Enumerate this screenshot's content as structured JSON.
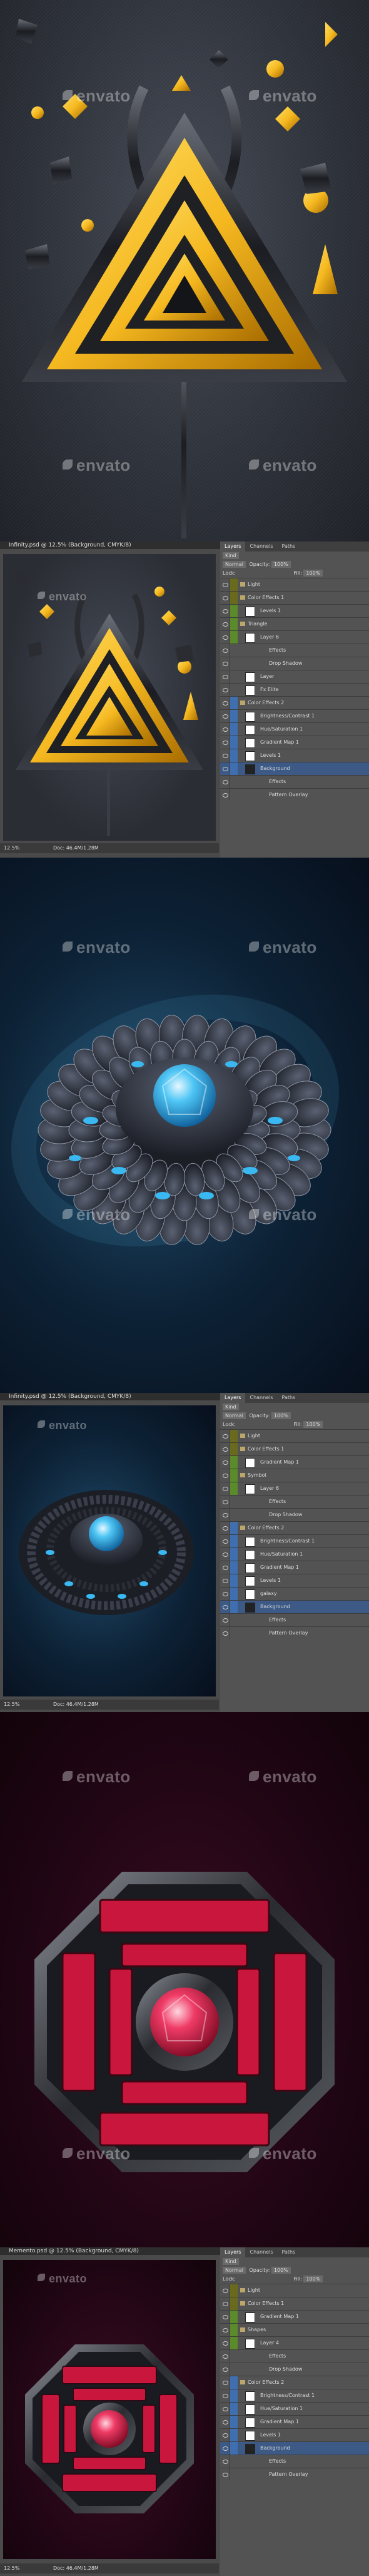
{
  "watermark": "envato",
  "colors": {
    "gold": "#f5b820",
    "blue_gem": "#2fb4f0",
    "crimson": "#c8163c",
    "ps_selected": "#3d5a86"
  },
  "screen1": {
    "ps": {
      "title": "Infinity.psd @ 12.5% (Background, CMYK/8)",
      "zoom": "12.5%",
      "doc": "Doc: 46.4M/1.28M",
      "tabs": [
        "Layers",
        "Channels",
        "Paths"
      ],
      "blend": "Normal",
      "opacity_label": "Opacity:",
      "opacity": "100%",
      "fill_label": "Fill:",
      "fill": "100%",
      "kind": "Kind",
      "lock": "Lock:",
      "layers": [
        {
          "name": "Light",
          "type": "folder",
          "color": "#6a6a1e"
        },
        {
          "name": "Color Effects 1",
          "type": "folder",
          "color": "#6a6a1e"
        },
        {
          "name": "Levels 1",
          "type": "layer",
          "color": "#5b8a2a"
        },
        {
          "name": "Triangle",
          "type": "folder",
          "color": "#5b8a2a"
        },
        {
          "name": "Layer 6",
          "type": "layer",
          "color": "#5b8a2a"
        },
        {
          "name": "Effects",
          "type": "fx",
          "color": ""
        },
        {
          "name": "Drop Shadow",
          "type": "fx",
          "color": ""
        },
        {
          "name": "Layer",
          "type": "layer",
          "color": ""
        },
        {
          "name": "Fx Elite",
          "type": "layer",
          "color": ""
        },
        {
          "name": "Color Effects 2",
          "type": "folder",
          "color": "#3f6fb0"
        },
        {
          "name": "Brightness/Contrast 1",
          "type": "layer",
          "color": "#3f6fb0"
        },
        {
          "name": "Hue/Saturation 1",
          "type": "layer",
          "color": "#3f6fb0"
        },
        {
          "name": "Gradient Map 1",
          "type": "layer",
          "color": "#3f6fb0"
        },
        {
          "name": "Levels 1",
          "type": "layer",
          "color": "#3f6fb0"
        },
        {
          "name": "Background",
          "type": "selected",
          "color": "#3f6fb0"
        },
        {
          "name": "Effects",
          "type": "fx",
          "color": ""
        },
        {
          "name": "Pattern Overlay",
          "type": "fx",
          "color": ""
        }
      ]
    }
  },
  "screen2": {
    "ps": {
      "title": "Infinity.psd @ 12.5% (Background, CMYK/8)",
      "zoom": "12.5%",
      "doc": "Doc: 46.4M/1.28M",
      "tabs": [
        "Layers",
        "Channels",
        "Paths"
      ],
      "blend": "Normal",
      "opacity_label": "Opacity:",
      "opacity": "100%",
      "fill_label": "Fill:",
      "fill": "100%",
      "kind": "Kind",
      "lock": "Lock:",
      "layers": [
        {
          "name": "Light",
          "type": "folder",
          "color": "#6a6a1e"
        },
        {
          "name": "Color Effects 1",
          "type": "folder",
          "color": "#6a6a1e"
        },
        {
          "name": "Gradient Map 1",
          "type": "layer",
          "color": "#5b8a2a"
        },
        {
          "name": "Symbol",
          "type": "folder",
          "color": "#5b8a2a"
        },
        {
          "name": "Layer 6",
          "type": "layer",
          "color": "#5b8a2a"
        },
        {
          "name": "Effects",
          "type": "fx",
          "color": ""
        },
        {
          "name": "Drop Shadow",
          "type": "fx",
          "color": ""
        },
        {
          "name": "Color Effects 2",
          "type": "folder",
          "color": "#3f6fb0"
        },
        {
          "name": "Brightness/Contrast 1",
          "type": "layer",
          "color": "#3f6fb0"
        },
        {
          "name": "Hue/Saturation 1",
          "type": "layer",
          "color": "#3f6fb0"
        },
        {
          "name": "Gradient Map 1",
          "type": "layer",
          "color": "#3f6fb0"
        },
        {
          "name": "Levels 1",
          "type": "layer",
          "color": "#3f6fb0"
        },
        {
          "name": "galaxy",
          "type": "layer",
          "color": "#3f6fb0"
        },
        {
          "name": "Background",
          "type": "selected",
          "color": "#3f6fb0"
        },
        {
          "name": "Effects",
          "type": "fx",
          "color": ""
        },
        {
          "name": "Pattern Overlay",
          "type": "fx",
          "color": ""
        }
      ]
    }
  },
  "screen3": {
    "ps": {
      "title": "Memento.psd @ 12.5% (Background, CMYK/8)",
      "zoom": "12.5%",
      "doc": "Doc: 46.4M/1.28M",
      "tabs": [
        "Layers",
        "Channels",
        "Paths"
      ],
      "blend": "Normal",
      "opacity_label": "Opacity:",
      "opacity": "100%",
      "fill_label": "Fill:",
      "fill": "100%",
      "kind": "Kind",
      "lock": "Lock:",
      "layers": [
        {
          "name": "Light",
          "type": "folder",
          "color": "#6a6a1e"
        },
        {
          "name": "Color Effects 1",
          "type": "folder",
          "color": "#6a6a1e"
        },
        {
          "name": "Gradient Map 1",
          "type": "layer",
          "color": "#5b8a2a"
        },
        {
          "name": "Shapes",
          "type": "folder",
          "color": "#5b8a2a"
        },
        {
          "name": "Layer 4",
          "type": "layer",
          "color": "#5b8a2a"
        },
        {
          "name": "Effects",
          "type": "fx",
          "color": ""
        },
        {
          "name": "Drop Shadow",
          "type": "fx",
          "color": ""
        },
        {
          "name": "Color Effects 2",
          "type": "folder",
          "color": "#3f6fb0"
        },
        {
          "name": "Brightness/Contrast 1",
          "type": "layer",
          "color": "#3f6fb0"
        },
        {
          "name": "Hue/Saturation 1",
          "type": "layer",
          "color": "#3f6fb0"
        },
        {
          "name": "Gradient Map 1",
          "type": "layer",
          "color": "#3f6fb0"
        },
        {
          "name": "Levels 1",
          "type": "layer",
          "color": "#3f6fb0"
        },
        {
          "name": "Background",
          "type": "selected",
          "color": "#3f6fb0"
        },
        {
          "name": "Effects",
          "type": "fx",
          "color": ""
        },
        {
          "name": "Pattern Overlay",
          "type": "fx",
          "color": ""
        }
      ]
    }
  }
}
